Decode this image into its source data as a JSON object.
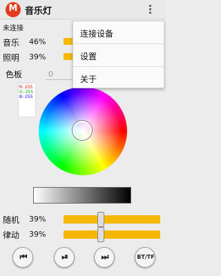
{
  "app": {
    "title": "音乐灯",
    "logo_letter": "M"
  },
  "status": "未连接",
  "rows": {
    "music": {
      "label": "音乐",
      "value": "46%"
    },
    "light": {
      "label": "照明",
      "value": "39%"
    }
  },
  "palette": {
    "label": "色板",
    "value": "0"
  },
  "rgb": {
    "r": "R: 255",
    "g": "G: 255",
    "b": "B: 255"
  },
  "sliders": [
    {
      "label": "随机",
      "value": "39%",
      "level": 0.39
    },
    {
      "label": "律动",
      "value": "39%",
      "level": 0.39
    }
  ],
  "controls": {
    "prev": "⏮",
    "play": "⏯",
    "next": "⏭",
    "bt_tf": "BT/TF"
  },
  "menu": [
    "连接设备",
    "设置",
    "关于"
  ],
  "colors": {
    "accent": "#f6b700",
    "logo": "#e53b1c"
  }
}
